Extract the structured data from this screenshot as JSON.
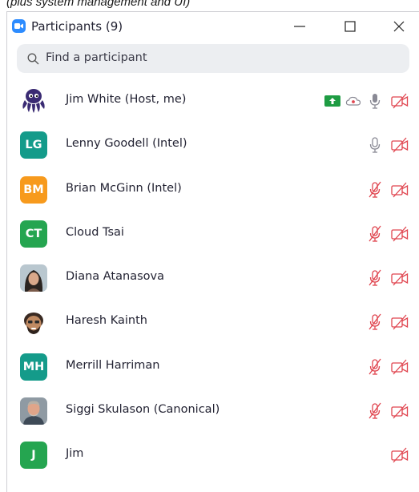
{
  "caption": "(plus system management and UI)",
  "window": {
    "title": "Participants (9)",
    "controls": {
      "minimize": "minimize-icon",
      "maximize": "maximize-icon",
      "close": "close-icon"
    }
  },
  "search": {
    "placeholder": "Find a participant"
  },
  "colors": {
    "accent": "#2d8cff",
    "muted_red": "#e0454f",
    "share_green": "#1e9c43",
    "avatar_green": "#25a550",
    "avatar_orange": "#f79a1d",
    "avatar_teal": "#149b8a"
  },
  "participants": [
    {
      "name": "Jim White (Host, me)",
      "initials": "",
      "avatar": "octopus-avatar",
      "sharing": true,
      "recording": true,
      "mic": "on",
      "video": "off"
    },
    {
      "name": "Lenny Goodell (Intel)",
      "initials": "LG",
      "avatar_color": "#149b8a",
      "mic": "on",
      "video": "off"
    },
    {
      "name": "Brian McGinn (Intel)",
      "initials": "BM",
      "avatar_color": "#f79a1d",
      "mic": "muted",
      "video": "off"
    },
    {
      "name": "Cloud Tsai",
      "initials": "CT",
      "avatar_color": "#25a550",
      "mic": "muted",
      "video": "off"
    },
    {
      "name": "Diana Atanasova",
      "initials": "",
      "avatar": "photo-avatar",
      "mic": "muted",
      "video": "off"
    },
    {
      "name": "Haresh Kainth",
      "initials": "",
      "avatar": "memoji-avatar",
      "mic": "muted",
      "video": "off"
    },
    {
      "name": "Merrill Harriman",
      "initials": "MH",
      "avatar_color": "#149b8a",
      "mic": "muted",
      "video": "off"
    },
    {
      "name": "Siggi Skulason (Canonical)",
      "initials": "",
      "avatar": "photo-avatar",
      "mic": "muted",
      "video": "off"
    },
    {
      "name": "Jim",
      "initials": "J",
      "avatar_color": "#25a550",
      "mic": "none",
      "video": "off"
    }
  ]
}
